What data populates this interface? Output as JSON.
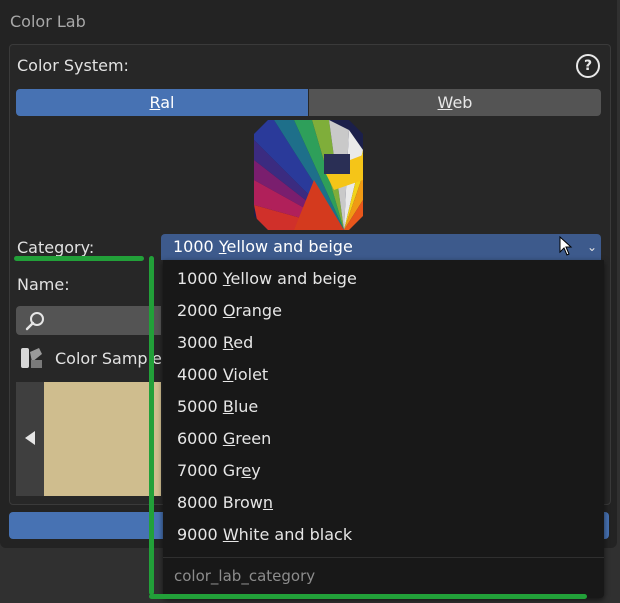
{
  "panel": {
    "title": "Color Lab"
  },
  "color_system": {
    "label": "Color System:",
    "help_glyph": "?",
    "options": [
      {
        "before": "",
        "u": "R",
        "after": "al",
        "selected": true
      },
      {
        "before": "",
        "u": "W",
        "after": "eb",
        "selected": false
      }
    ]
  },
  "image": {
    "name": "ral-color-fan-image"
  },
  "category": {
    "label": "Category:",
    "selected": {
      "before": "1000 ",
      "u": "Y",
      "after": "ellow and beige"
    },
    "chevron": "⌄"
  },
  "name": {
    "label": "Name:"
  },
  "color_sample": {
    "label": "Color Sample",
    "color": "#cfbd8e"
  },
  "dropdown": {
    "items": [
      {
        "before": "1000 ",
        "u": "Y",
        "after": "ellow and beige"
      },
      {
        "before": "2000 ",
        "u": "O",
        "after": "range"
      },
      {
        "before": "3000 ",
        "u": "R",
        "after": "ed"
      },
      {
        "before": "4000 ",
        "u": "V",
        "after": "iolet"
      },
      {
        "before": "5000 ",
        "u": "B",
        "after": "lue"
      },
      {
        "before": "6000 ",
        "u": "G",
        "after": "reen"
      },
      {
        "before": "7000 Gr",
        "u": "e",
        "after": "y"
      },
      {
        "before": "8000 Brow",
        "u": "n",
        "after": ""
      },
      {
        "before": "9000 ",
        "u": "W",
        "after": "hite and black"
      }
    ],
    "footer": "color_lab_category"
  },
  "colors": {
    "accent": "#4772b3",
    "highlight": "#22a039",
    "panel_bg": "#232323",
    "dropdown_bg": "#181818"
  }
}
